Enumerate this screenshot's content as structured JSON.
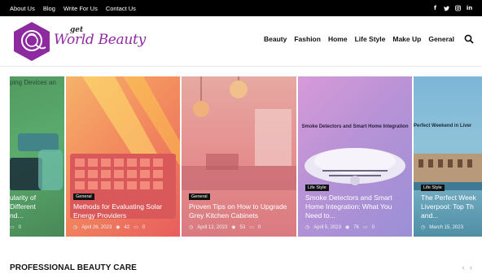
{
  "topbar": {
    "links": [
      "About Us",
      "Blog",
      "Write For Us",
      "Contact Us"
    ],
    "social": [
      {
        "icon": "facebook-icon",
        "glyph": "f"
      },
      {
        "icon": "twitter-icon",
        "glyph": "t"
      },
      {
        "icon": "instagram-icon",
        "glyph": "◎"
      },
      {
        "icon": "linkedin-icon",
        "glyph": "in"
      }
    ]
  },
  "logo": {
    "small": "get",
    "brand": "World Beauty",
    "brand_color": "#8e2aa0"
  },
  "nav": {
    "items": [
      "Beauty",
      "Fashion",
      "Home",
      "Life Style",
      "Make Up",
      "General"
    ],
    "search_icon": "search-icon"
  },
  "slider": {
    "cards": [
      {
        "partial": true,
        "heading_fragment": "...ping Devices an...",
        "category": "",
        "title": "...ularity of ...d Different ...nd...",
        "date": "",
        "views": "",
        "comments": "0",
        "overlay": "#5fb27a"
      },
      {
        "category": "General",
        "title": "Methods for Evaluating Solar Energy Providers",
        "date": "April 26, 2023",
        "views": "42",
        "comments": "0",
        "overlay": "#f08a6c"
      },
      {
        "category": "General",
        "title": "Proven Tips on How to Upgrade Grey Kitchen Cabinets",
        "date": "April 12, 2023",
        "views": "53",
        "comments": "0",
        "overlay": "#e87a82"
      },
      {
        "category": "Life Style",
        "title": "Smoke Detectors and Smart Home Integration: What You Need to...",
        "date": "April 5, 2023",
        "views": "76",
        "comments": "0",
        "overlay": "#b98ad1",
        "image_caption": "Smoke Detectors and Smart Home Integration"
      },
      {
        "category": "Life Style",
        "title": "The Perfect Weekend in Liverpool: Top Thi... and...",
        "date": "March 15, 2023",
        "views": "",
        "comments": "",
        "overlay": "#6aa7c9",
        "image_caption": "Perfect Weekend in Liver..."
      }
    ]
  },
  "section": {
    "title": "PROFESSIONAL BEAUTY CARE",
    "prev": "‹",
    "next": "›"
  }
}
